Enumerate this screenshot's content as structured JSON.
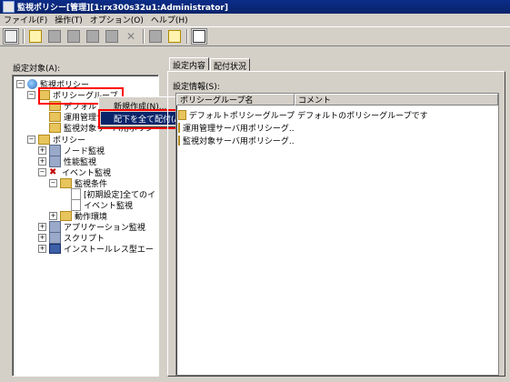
{
  "window": {
    "title": "監視ポリシー[管理][1:rx300s32u1:Administrator]"
  },
  "menu": [
    "ファイル(F)",
    "操作(T)",
    "オプション(O)",
    "ヘルプ(H)"
  ],
  "left": {
    "label": "設定対象(A):"
  },
  "tree": {
    "root": "監視ポリシー",
    "policy_group": "ポリシーグループ",
    "default_item": "デフォル",
    "ops_item": "運用管理サ",
    "monitor_item": "監視対象サーバ用ポリシ",
    "policy": "ポリシー",
    "node_mon": "ノード監視",
    "perf_mon": "性能監視",
    "event_mon": "イベント監視",
    "cond": "監視条件",
    "cond_item1": "[初期設定]全てのイ",
    "cond_item2": "イベント監視",
    "env": "動作環境",
    "app_mon": "アプリケーション監視",
    "script": "スクリプト",
    "agentless": "インストールレス型エー"
  },
  "context_menu": {
    "items": [
      "新規作成(N)...",
      "配下を全て配付(A)"
    ]
  },
  "right": {
    "tabs": [
      "設定内容",
      "配付状況"
    ],
    "label": "設定情報(S):",
    "columns": [
      "ポリシーグループ名",
      "コメント"
    ],
    "rows": [
      [
        "デフォルトポリシーグループ",
        "デフォルトのポリシーグループです"
      ],
      [
        "運用管理サーバ用ポリシーグ...",
        ""
      ],
      [
        "監視対象サーバ用ポリシーグ...",
        ""
      ]
    ]
  }
}
